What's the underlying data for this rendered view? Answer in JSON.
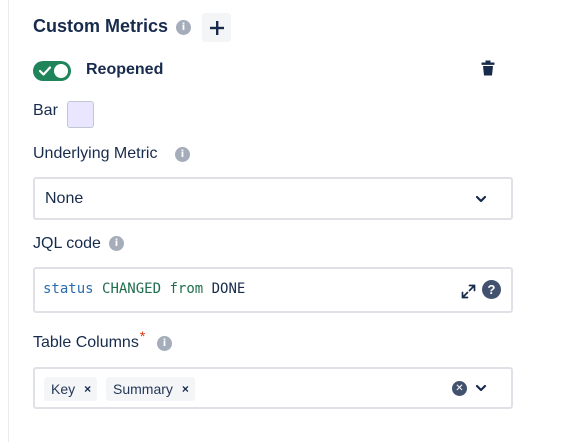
{
  "header": {
    "title": "Custom Metrics",
    "info_icon": "info-icon",
    "add_icon": "plus-icon"
  },
  "metric": {
    "enabled": true,
    "name": "Reopened",
    "delete_icon": "trash-icon",
    "chart_type_label": "Bar",
    "color": "#eae6ff"
  },
  "underlying_metric": {
    "label": "Underlying Metric",
    "value": "None"
  },
  "jql": {
    "label": "JQL code",
    "tokens": [
      "status",
      "CHANGED",
      "from",
      "DONE"
    ],
    "expand_icon": "expand-icon",
    "help_icon": "question-icon",
    "help_glyph": "?"
  },
  "table_columns": {
    "label": "Table Columns",
    "required_marker": "*",
    "chips": [
      {
        "label": "Key",
        "remove": "×"
      },
      {
        "label": "Summary",
        "remove": "×"
      }
    ]
  },
  "colors": {
    "toggle_on": "#1f845a",
    "accent_blue": "#2b6cb0",
    "text": "#172b4d"
  }
}
